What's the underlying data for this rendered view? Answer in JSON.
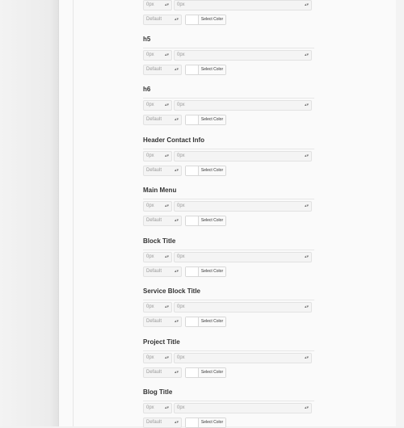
{
  "size_placeholder": "0px",
  "line_height_placeholder": "0px",
  "style_default": "Default",
  "select_color_label": "Select Color",
  "sections": [
    {
      "label": ""
    },
    {
      "label": "h5"
    },
    {
      "label": "h6"
    },
    {
      "label": "Header Contact Info"
    },
    {
      "label": "Main Menu"
    },
    {
      "label": "Block Title"
    },
    {
      "label": "Service Block Title"
    },
    {
      "label": "Project Title"
    },
    {
      "label": "Blog Title"
    }
  ]
}
